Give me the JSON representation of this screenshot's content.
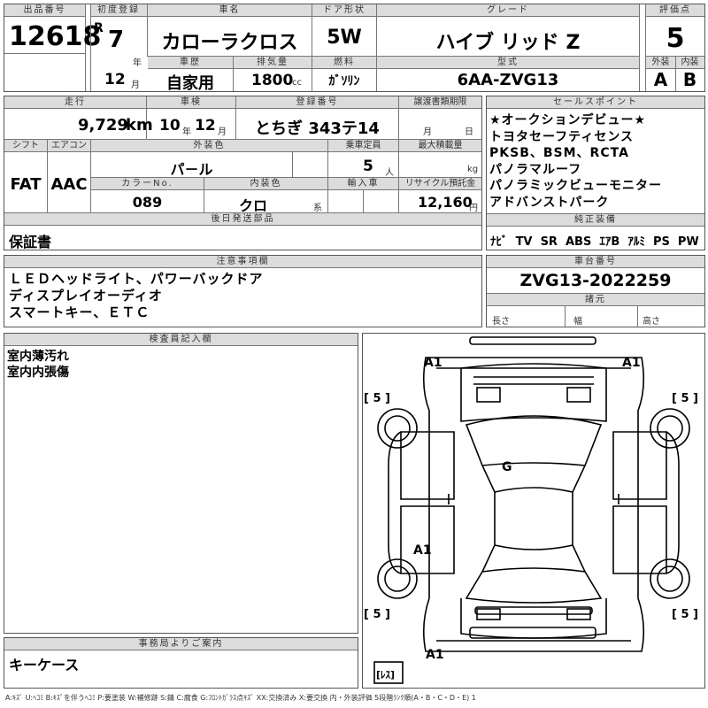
{
  "lot": {
    "label": "出品番号",
    "value": "12618"
  },
  "first_reg": {
    "label": "初度登録",
    "era": "R",
    "year": "7",
    "year_unit": "年",
    "month": "12",
    "month_unit": "月"
  },
  "car_name": {
    "label": "車名",
    "value": "カローラクロス"
  },
  "door": {
    "label": "ドア形状",
    "value": "5W"
  },
  "grade": {
    "label": "グレード",
    "value": "ハイブ リッド Z"
  },
  "score": {
    "label": "評価点",
    "value": "5",
    "ext_label": "外装",
    "ext_value": "A",
    "int_label": "内装",
    "int_value": "B"
  },
  "history": {
    "label": "車歴",
    "value": "自家用"
  },
  "displacement": {
    "label": "排気量",
    "value": "1800",
    "unit": "cc"
  },
  "fuel": {
    "label": "燃料",
    "value": "ｶﾞｿﾘﾝ"
  },
  "model": {
    "label": "型式",
    "value": "6AA-ZVG13"
  },
  "mileage": {
    "label": "走行",
    "value": "9,729",
    "unit": "km"
  },
  "inspection": {
    "label": "車検",
    "year": "10",
    "year_unit": "年",
    "month": "12",
    "month_unit": "月"
  },
  "plate": {
    "label": "登録番号",
    "value": "とちぎ 343テ14"
  },
  "transfer": {
    "label": "譲渡書類期限",
    "month_unit": "月",
    "day_unit": "日"
  },
  "shift": {
    "label": "シフト",
    "value": "FAT"
  },
  "aircon": {
    "label": "エアコン",
    "value": "AAC"
  },
  "ext_color": {
    "label": "外装色",
    "value": "パ－ル"
  },
  "capacity": {
    "label": "乗車定員",
    "value": "5",
    "unit": "人"
  },
  "max_load": {
    "label": "最大積載量",
    "unit": "kg"
  },
  "color_no": {
    "label": "カラーNo.",
    "value": "089"
  },
  "int_color": {
    "label": "内装色",
    "value": "クロ",
    "unit": "系"
  },
  "import": {
    "label": "輸入車"
  },
  "recycle": {
    "label": "リサイクル預託金",
    "value": "12,160",
    "unit": "円"
  },
  "later_parts": {
    "label": "後日発送部品",
    "value": "保証書"
  },
  "sales_points": {
    "label": "セールスポイント",
    "lines": [
      "★オークションデビュー★",
      "トヨタセーフティセンス",
      "PKSB、BSM、RCTA",
      "パノラマルーフ",
      "パノラミックビューモニター",
      "アドバンストパーク"
    ]
  },
  "equipment": {
    "label": "純正装備",
    "items": [
      "ﾅﾋﾞ",
      "TV",
      "SR",
      "ABS",
      "ｴｱB",
      "ｱﾙﾐ",
      "PS",
      "PW"
    ]
  },
  "notes": {
    "label": "注意事項欄",
    "lines": [
      "ＬＥＤヘッドライト、パワーバックドア",
      "ディスプレイオーディオ",
      "スマートキー、ＥＴＣ"
    ]
  },
  "chassis": {
    "label": "車台番号",
    "value": "ZVG13-2022259",
    "spec_label": "諸元",
    "length": "長さ",
    "width": "幅",
    "height": "高さ"
  },
  "inspector": {
    "label": "検査員記入欄",
    "lines": [
      "室内薄汚れ",
      "室内内張傷"
    ]
  },
  "office": {
    "label": "事務局よりご案内",
    "value": "キーケース"
  },
  "diagram": {
    "marks": [
      "A1",
      "A1",
      "G",
      "A1",
      "A1"
    ],
    "tires": [
      "[ 5 ]",
      "[ 5 ]",
      "[ 5 ]",
      "[ 5 ]"
    ],
    "spare": "[ﾚｽ]"
  },
  "legend": "A:ｷｽﾞ U:ﾍｺﾐ B:ｷｽﾞを伴うﾍｺﾐ P:要塗装 W:補修跡 S:錆 C:腐食 G:ﾌﾛﾝﾄｶﾞﾗｽ点ｷｽﾞ XX:交換済み X:要交換 内・外装評価 5段階ﾗﾝｸ順(A・B・C・D・E) 1"
}
